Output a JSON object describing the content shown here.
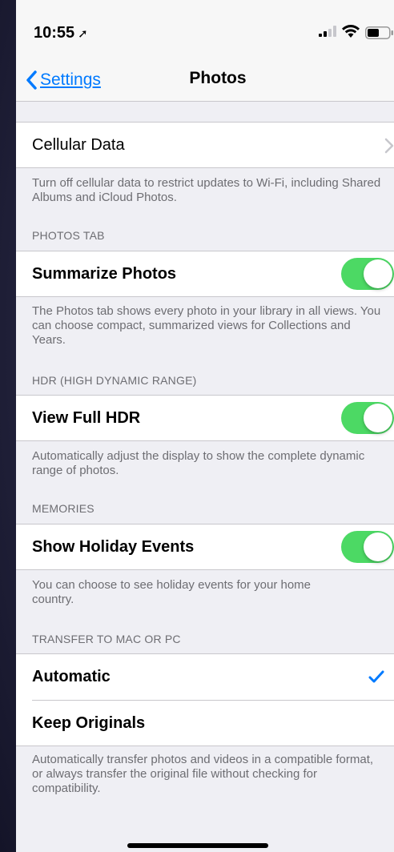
{
  "status": {
    "time": "10:55"
  },
  "nav": {
    "back_label": "Settings",
    "title": "Photos"
  },
  "cellular": {
    "label": "Cellular Data",
    "footer": "Turn off cellular data to restrict updates to Wi-Fi, including Shared Albums and iCloud Photos."
  },
  "photos_tab": {
    "header": "PHOTOS TAB",
    "label": "Summarize Photos",
    "toggle_on": true,
    "footer": "The Photos tab shows every photo in your library in all views. You can choose compact, summarized views for Collections and Years."
  },
  "hdr": {
    "header": "HDR (HIGH DYNAMIC RANGE)",
    "label": "View Full HDR",
    "toggle_on": true,
    "footer": "Automatically adjust the display to show the complete dynamic range of photos."
  },
  "memories": {
    "header": "MEMORIES",
    "label": "Show Holiday Events",
    "toggle_on": true,
    "footer": "You can choose to see holiday events for your home country."
  },
  "transfer": {
    "header": "TRANSFER TO MAC OR PC",
    "options": [
      {
        "label": "Automatic",
        "selected": true
      },
      {
        "label": "Keep Originals",
        "selected": false
      }
    ],
    "footer": "Automatically transfer photos and videos in a compatible format, or always transfer the original file without checking for compatibility."
  },
  "colors": {
    "accent": "#007aff",
    "toggle_on": "#4cd964"
  }
}
